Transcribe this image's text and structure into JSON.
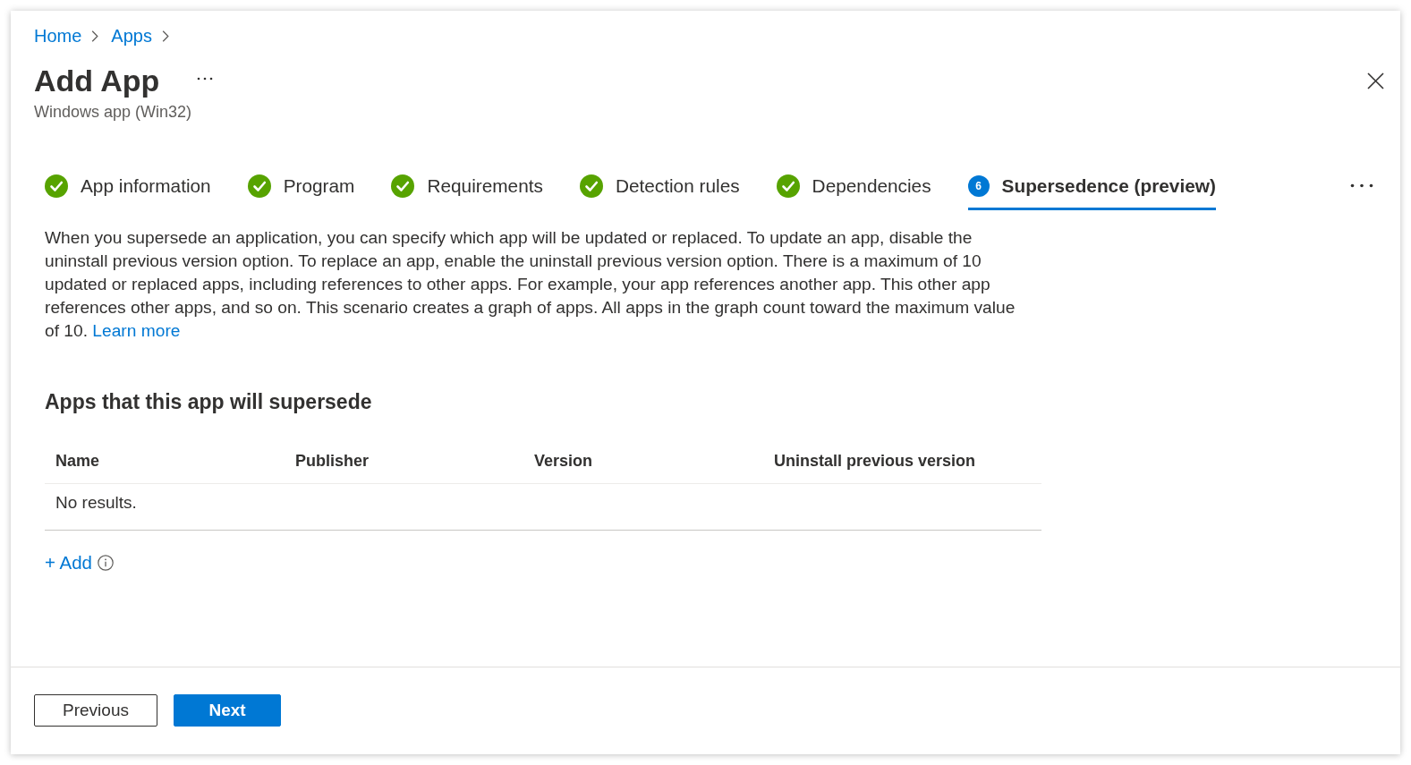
{
  "breadcrumb": [
    {
      "label": "Home"
    },
    {
      "label": "Apps"
    }
  ],
  "header": {
    "title": "Add App",
    "subtitle": "Windows app (Win32)"
  },
  "steps": [
    {
      "label": "App information",
      "kind": "done",
      "selected": false
    },
    {
      "label": "Program",
      "kind": "done",
      "selected": false
    },
    {
      "label": "Requirements",
      "kind": "done",
      "selected": false
    },
    {
      "label": "Detection rules",
      "kind": "done",
      "selected": false
    },
    {
      "label": "Dependencies",
      "kind": "done",
      "selected": false
    },
    {
      "label": "Supersedence (preview)",
      "kind": "current",
      "number": "6",
      "selected": true
    }
  ],
  "description": {
    "text": "When you supersede an application, you can specify which app will be updated or replaced. To update an app, disable the uninstall previous version option. To replace an app, enable the uninstall previous version option. There is a maximum of 10 updated or replaced apps, including references to other apps. For example, your app references another app. This other app references other apps, and so on. This scenario creates a graph of apps. All apps in the graph count toward the maximum value of 10.",
    "link": "Learn more"
  },
  "section": {
    "heading": "Apps that this app will supersede",
    "table": {
      "columns": [
        "Name",
        "Publisher",
        "Version",
        "Uninstall previous version"
      ],
      "empty_text": "No results."
    },
    "add_link": "+ Add"
  },
  "footer": {
    "buttons": [
      {
        "label": "Previous",
        "kind": "secondary"
      },
      {
        "label": "Next",
        "kind": "primary"
      }
    ]
  }
}
